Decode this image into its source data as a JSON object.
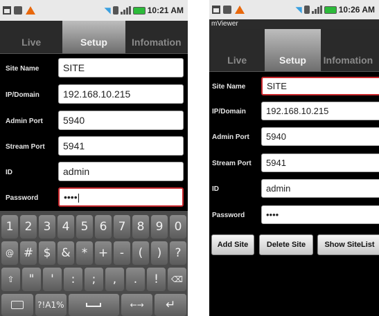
{
  "left_phone": {
    "status": {
      "time": "10:21 AM"
    },
    "tabs": [
      {
        "label": "Live",
        "active": false
      },
      {
        "label": "Setup",
        "active": true
      },
      {
        "label": "Infomation",
        "active": false
      }
    ],
    "fields": [
      {
        "label": "Site Name",
        "value": "SITE",
        "focused": false
      },
      {
        "label": "IP/Domain",
        "value": "192.168.10.215",
        "focused": false
      },
      {
        "label": "Admin Port",
        "value": "5940",
        "focused": false
      },
      {
        "label": "Stream Port",
        "value": "5941",
        "focused": false
      },
      {
        "label": "ID",
        "value": "admin",
        "focused": false
      },
      {
        "label": "Password",
        "value": "••••|",
        "focused": true
      }
    ],
    "keyboard": {
      "row1": [
        "1",
        "2",
        "3",
        "4",
        "5",
        "6",
        "7",
        "8",
        "9",
        "0"
      ],
      "row2": [
        "@",
        "#",
        "$",
        "&",
        "*",
        "+",
        "-",
        "(",
        ")",
        "?"
      ],
      "row3": [
        "⇧",
        "\"",
        "'",
        ":",
        ";",
        ",",
        ".",
        "!",
        "⌫"
      ],
      "row4": [
        "keyboard-icon",
        "?!A1%",
        "space",
        "←→",
        "↵"
      ]
    }
  },
  "right_phone": {
    "status": {
      "time": "10:26 AM"
    },
    "app_title": "mViewer",
    "tabs": [
      {
        "label": "Live",
        "active": false
      },
      {
        "label": "Setup",
        "active": true
      },
      {
        "label": "Infomation",
        "active": false
      }
    ],
    "fields": [
      {
        "label": "Site Name",
        "value": "SITE",
        "focused": true
      },
      {
        "label": "IP/Domain",
        "value": "192.168.10.215",
        "focused": false
      },
      {
        "label": "Admin Port",
        "value": "5940",
        "focused": false
      },
      {
        "label": "Stream Port",
        "value": "5941",
        "focused": false
      },
      {
        "label": "ID",
        "value": "admin",
        "focused": false
      },
      {
        "label": "Password",
        "value": "••••",
        "focused": false
      }
    ],
    "actions": [
      {
        "label": "Add Site"
      },
      {
        "label": "Delete Site"
      },
      {
        "label": "Show SiteList"
      }
    ]
  },
  "colors": {
    "focus_border": "#c9282d",
    "tab_active_top": "#bdbdbd",
    "screen_bg": "#000000",
    "battery": "#2cba3a",
    "warning": "#e8680c"
  }
}
